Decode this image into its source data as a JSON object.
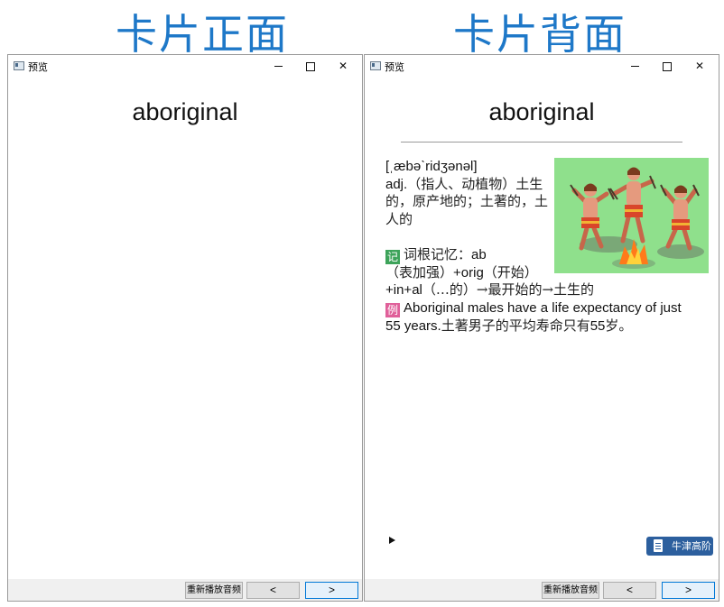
{
  "headings": {
    "front": "卡片正面",
    "back": "卡片背面"
  },
  "front_window": {
    "title": "预览",
    "word": "aboriginal",
    "footer": {
      "replay_label": "重新播放音频",
      "prev_label": "<",
      "next_label": ">"
    }
  },
  "back_window": {
    "title": "预览",
    "word": "aboriginal",
    "phonetic": "[ˌæbəˋridʒənəl]",
    "definition": {
      "pos": "adj.",
      "text": "（指人、动植物）土生的，原产地的；土著的，土人的"
    },
    "mnemonic": {
      "badge": "记",
      "label": "词根记忆：",
      "text_1": "ab",
      "text_2": "（表加强）",
      "text_3": "+orig",
      "text_4": "（开始）",
      "text_5": "+in+al",
      "text_6": "（…的）→最开始的→土生的"
    },
    "example": {
      "badge": "例",
      "en": "Aboriginal males have a life expectancy of just 55 years.",
      "cn_1": "土著男子的平均寿命只有",
      "cn_num": "55",
      "cn_2": "岁。"
    },
    "illustration_icon": "dancing-aborigines-illustration",
    "dict_label": "牛津高阶",
    "footer": {
      "replay_label": "重新播放音频",
      "prev_label": "<",
      "next_label": ">"
    }
  },
  "colors": {
    "heading": "#1e78c8",
    "illustration_bg": "#8fe08c",
    "badge_ji": "#3da35a",
    "badge_li": "#e0609a",
    "dict_badge": "#2c5f9e"
  }
}
